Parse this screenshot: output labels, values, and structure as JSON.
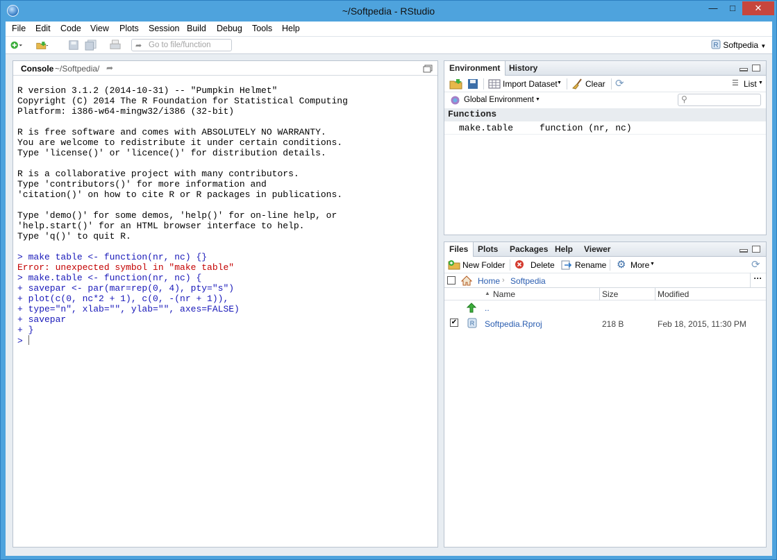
{
  "window": {
    "title": "~/Softpedia - RStudio"
  },
  "menu": [
    "File",
    "Edit",
    "Code",
    "View",
    "Plots",
    "Session",
    "Build",
    "Debug",
    "Tools",
    "Help"
  ],
  "toolbar": {
    "goto_placeholder": "Go to file/function",
    "project": "Softpedia"
  },
  "console": {
    "tab_label": "Console",
    "path": "~/Softpedia/",
    "lines": [
      {
        "text": "R version 3.1.2 (2014-10-31) -- \"Pumpkin Helmet\"",
        "color": "black"
      },
      {
        "text": "Copyright (C) 2014 The R Foundation for Statistical Computing",
        "color": "black"
      },
      {
        "text": "Platform: i386-w64-mingw32/i386 (32-bit)",
        "color": "black"
      },
      {
        "text": "",
        "color": "black"
      },
      {
        "text": "R is free software and comes with ABSOLUTELY NO WARRANTY.",
        "color": "black"
      },
      {
        "text": "You are welcome to redistribute it under certain conditions.",
        "color": "black"
      },
      {
        "text": "Type 'license()' or 'licence()' for distribution details.",
        "color": "black"
      },
      {
        "text": "",
        "color": "black"
      },
      {
        "text": "R is a collaborative project with many contributors.",
        "color": "black"
      },
      {
        "text": "Type 'contributors()' for more information and",
        "color": "black"
      },
      {
        "text": "'citation()' on how to cite R or R packages in publications.",
        "color": "black"
      },
      {
        "text": "",
        "color": "black"
      },
      {
        "text": "Type 'demo()' for some demos, 'help()' for on-line help, or",
        "color": "black"
      },
      {
        "text": "'help.start()' for an HTML browser interface to help.",
        "color": "black"
      },
      {
        "text": "Type 'q()' to quit R.",
        "color": "black"
      },
      {
        "text": "",
        "color": "black"
      },
      {
        "text": "> make table <- function(nr, nc) {}",
        "color": "blue"
      },
      {
        "text": "Error: unexpected symbol in \"make table\"",
        "color": "red"
      },
      {
        "text": "> make.table <- function(nr, nc) {",
        "color": "blue"
      },
      {
        "text": "+ savepar <- par(mar=rep(0, 4), pty=\"s\")",
        "color": "blue"
      },
      {
        "text": "+ plot(c(0, nc*2 + 1), c(0, -(nr + 1)),",
        "color": "blue"
      },
      {
        "text": "+ type=\"n\", xlab=\"\", ylab=\"\", axes=FALSE)",
        "color": "blue"
      },
      {
        "text": "+ savepar",
        "color": "blue"
      },
      {
        "text": "+ }",
        "color": "blue"
      },
      {
        "text": "> ",
        "color": "blue"
      }
    ]
  },
  "environment": {
    "tabs": [
      "Environment",
      "History"
    ],
    "import_label": "Import Dataset",
    "clear_label": "Clear",
    "view_mode": "List",
    "scope": "Global Environment",
    "section": "Functions",
    "rows": [
      {
        "name": "make.table",
        "value": "function (nr, nc)"
      }
    ]
  },
  "files": {
    "tabs": [
      "Files",
      "Plots",
      "Packages",
      "Help",
      "Viewer"
    ],
    "new_folder": "New Folder",
    "delete": "Delete",
    "rename": "Rename",
    "more": "More",
    "breadcrumb": [
      "Home",
      "Softpedia"
    ],
    "columns": [
      "Name",
      "Size",
      "Modified"
    ],
    "up_label": "..",
    "rows": [
      {
        "name": "Softpedia.Rproj",
        "size": "218 B",
        "modified": "Feb 18, 2015, 11:30 PM",
        "checked": true
      }
    ]
  },
  "colors": {
    "accent": "#4ea3dd",
    "console_blue": "#1717b9",
    "console_red": "#c30000"
  }
}
